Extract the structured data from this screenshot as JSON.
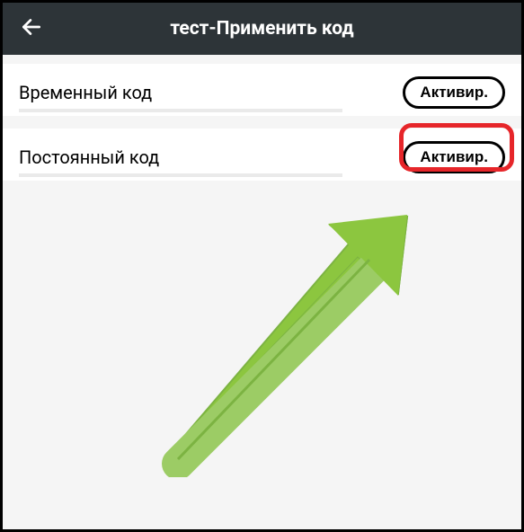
{
  "header": {
    "title": "тест-Применить код"
  },
  "rows": [
    {
      "label": "Временный код",
      "button": "Активир."
    },
    {
      "label": "Постоянный код",
      "button": "Активир."
    }
  ]
}
